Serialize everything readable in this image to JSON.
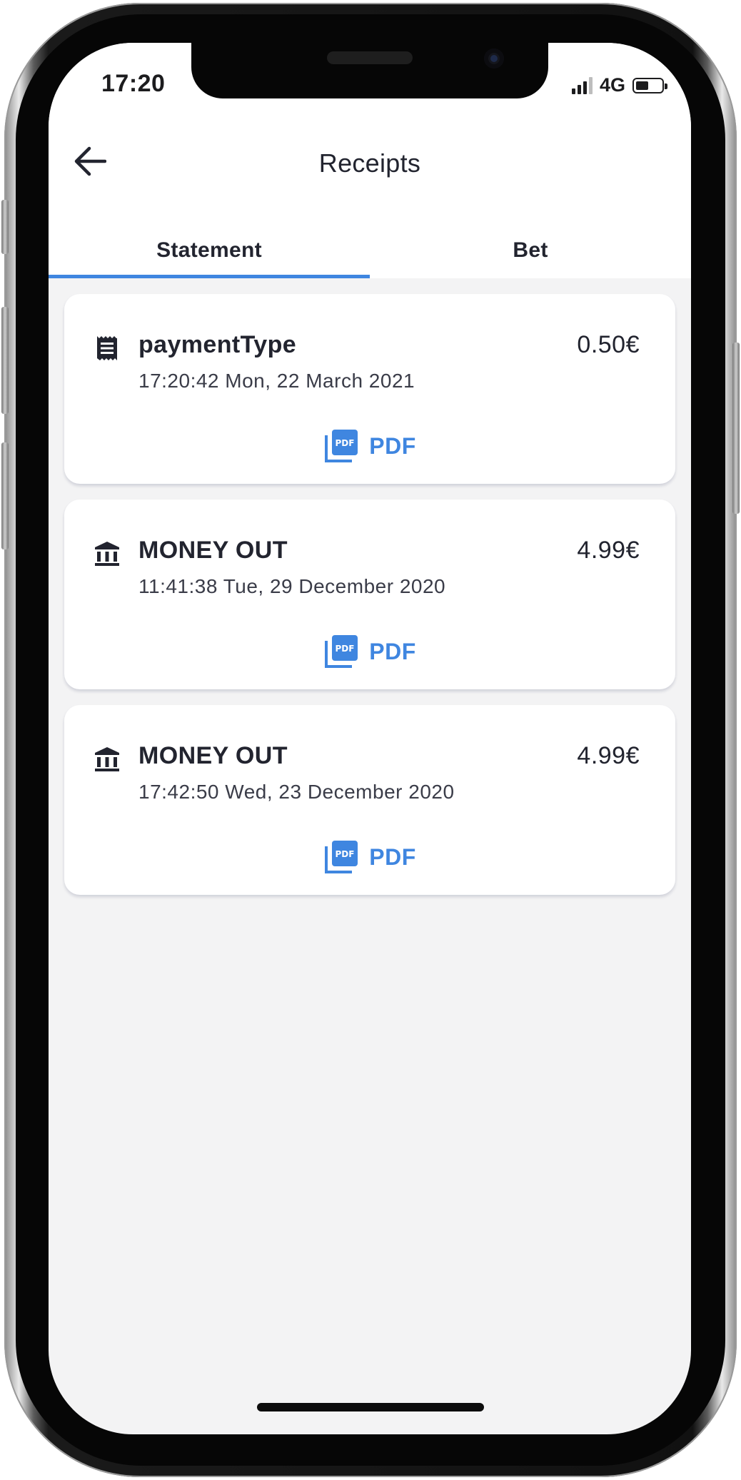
{
  "status_bar": {
    "time": "17:20",
    "network": "4G",
    "signal_bars": 3,
    "battery_level": 0.45
  },
  "header": {
    "title": "Receipts",
    "back_icon": "arrow-left-icon"
  },
  "tabs": [
    {
      "label": "Statement",
      "active": true
    },
    {
      "label": "Bet",
      "active": false
    }
  ],
  "receipts": [
    {
      "icon": "receipt-icon",
      "title": "paymentType",
      "amount": "0.50€",
      "datetime": "17:20:42 Mon, 22 March 2021",
      "pdf_label": "PDF"
    },
    {
      "icon": "bank-icon",
      "title": "MONEY OUT",
      "amount": "4.99€",
      "datetime": "11:41:38 Tue, 29 December 2020",
      "pdf_label": "PDF"
    },
    {
      "icon": "bank-icon",
      "title": "MONEY OUT",
      "amount": "4.99€",
      "datetime": "17:42:50 Wed, 23 December 2020",
      "pdf_label": "PDF"
    }
  ],
  "colors": {
    "accent": "#3f86e0",
    "text_primary": "#22242f",
    "background": "#f3f3f4",
    "card": "#ffffff"
  }
}
